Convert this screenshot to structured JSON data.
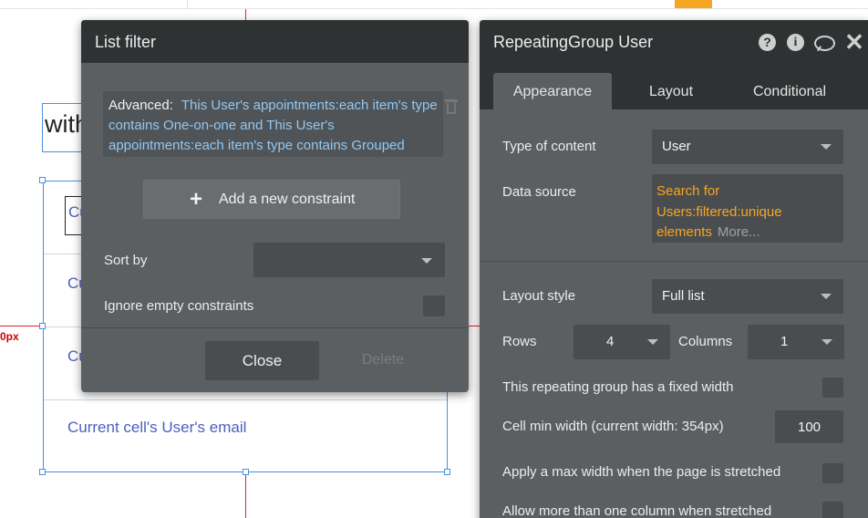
{
  "canvas": {
    "guide_label": "0px",
    "heading_fragment": "with",
    "cell_input_fragment": "Cu",
    "cell_fragment_2": "Cu",
    "cell_fragment_3": "Cu",
    "cell_email_text": "Current cell's User's email",
    "accent_color": "#f5a623",
    "guide_color": "#dd2222"
  },
  "list_filter": {
    "title": "List filter",
    "advanced_label": "Advanced:",
    "advanced_expression": "This User's appointments:each item's type contains One-on-one and This User's appointments:each item's type contains Grouped",
    "add_constraint_label": "Add a new constraint",
    "sort_by_label": "Sort by",
    "sort_by_value": "",
    "ignore_empty_label": "Ignore empty constraints",
    "ignore_empty_checked": false,
    "close_label": "Close",
    "delete_label": "Delete"
  },
  "property_editor": {
    "title": "RepeatingGroup User",
    "header_icons": [
      "help-icon",
      "info-icon",
      "comment-icon",
      "close-icon"
    ],
    "help_glyph": "?",
    "info_glyph": "i",
    "close_glyph": "✕",
    "tabs": [
      {
        "label": "Appearance",
        "active": true
      },
      {
        "label": "Layout",
        "active": false
      },
      {
        "label": "Conditional",
        "active": false
      }
    ],
    "type_of_content": {
      "label": "Type of content",
      "value": "User"
    },
    "data_source": {
      "label": "Data source",
      "value": "Search for Users:filtered:unique elements",
      "more_label": "More..."
    },
    "layout_style": {
      "label": "Layout style",
      "value": "Full list"
    },
    "rows": {
      "label": "Rows",
      "value": "4"
    },
    "columns": {
      "label": "Columns",
      "value": "1"
    },
    "fixed_width": {
      "label": "This repeating group has a fixed width",
      "checked": false
    },
    "cell_min_width": {
      "label": "Cell min width (current width: 354px)",
      "value": "100"
    },
    "max_width_stretched": {
      "label": "Apply a max width when the page is stretched",
      "checked": false
    },
    "more_columns_stretched": {
      "label": "Allow more than one column when stretched",
      "checked": false
    },
    "data_source_color": "#f5a623",
    "expression_color": "#8fc8f5"
  }
}
